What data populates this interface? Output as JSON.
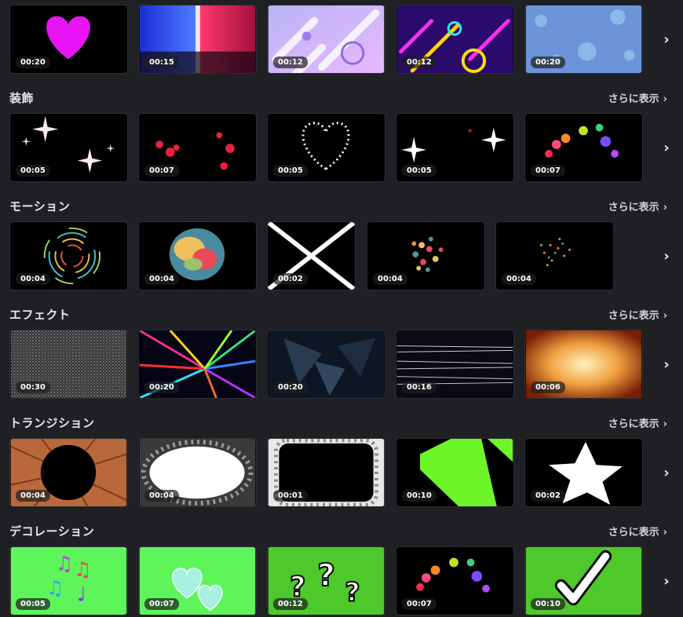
{
  "more_label": "さらに表示",
  "next_icon": "chevron-right-icon",
  "rows": [
    {
      "durations": [
        "00:20",
        "00:15",
        "00:12",
        "00:12",
        "00:20"
      ]
    },
    {
      "title": "装飾",
      "durations": [
        "00:05",
        "00:07",
        "00:05",
        "00:05",
        "00:07"
      ]
    },
    {
      "title": "モーション",
      "durations": [
        "00:04",
        "00:04",
        "00:02",
        "00:04",
        "00:04"
      ]
    },
    {
      "title": "エフェクト",
      "durations": [
        "00:30",
        "00:20",
        "00:20",
        "00:16",
        "00:06"
      ]
    },
    {
      "title": "トランジション",
      "durations": [
        "00:04",
        "00:04",
        "00:01",
        "00:10",
        "00:02"
      ]
    },
    {
      "title": "デコレーション",
      "durations": [
        "00:05",
        "00:07",
        "00:12",
        "00:07",
        "00:10"
      ]
    }
  ]
}
